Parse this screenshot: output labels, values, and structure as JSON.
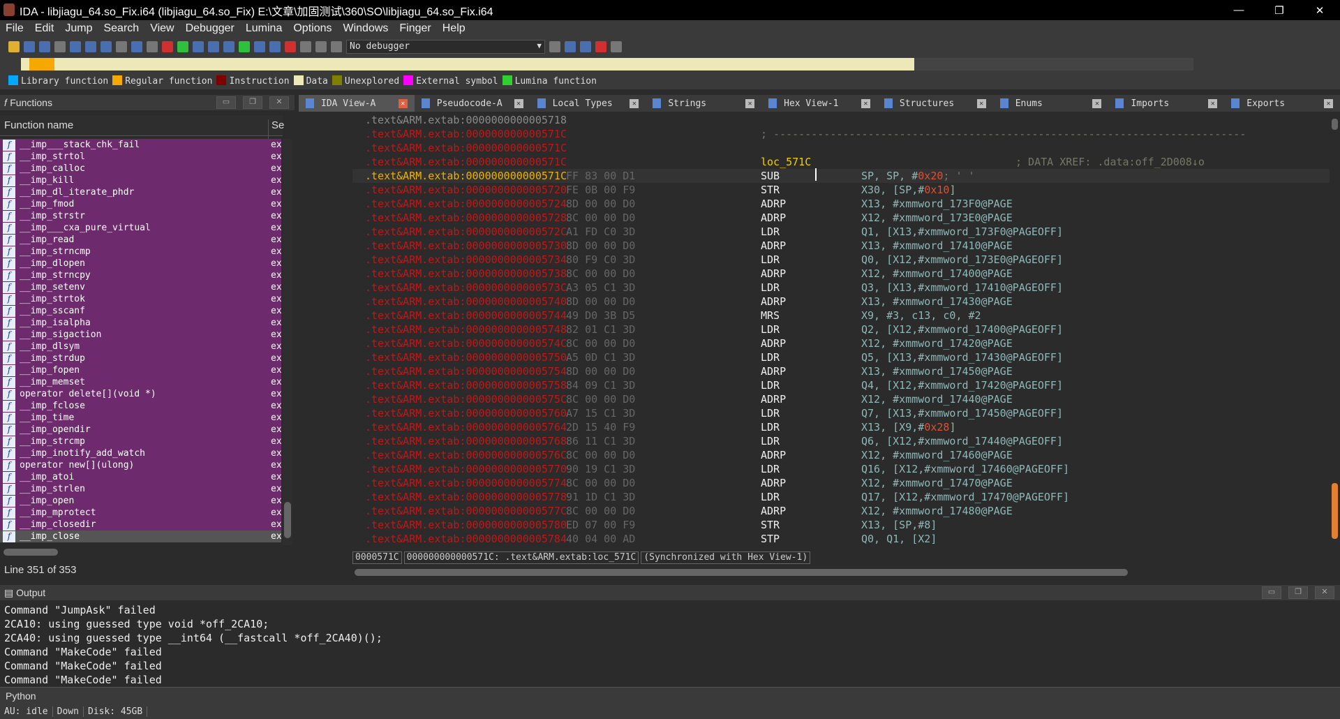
{
  "window": {
    "title": "IDA - libjiagu_64.so_Fix.i64 (libjiagu_64.so_Fix) E:\\文章\\加固测试\\360\\SO\\libjiagu_64.so_Fix.i64",
    "minimize": "—",
    "restore": "❐",
    "close": "✕"
  },
  "menu": [
    "File",
    "Edit",
    "Jump",
    "Search",
    "View",
    "Debugger",
    "Lumina",
    "Options",
    "Windows",
    "Finger",
    "Help"
  ],
  "toolbar": {
    "debugger_select": "No debugger"
  },
  "legend": [
    {
      "label": "Library function",
      "color": "#00a8ff"
    },
    {
      "label": "Regular function",
      "color": "#f5a800"
    },
    {
      "label": "Instruction",
      "color": "#800000"
    },
    {
      "label": "Data",
      "color": "#ede8b8"
    },
    {
      "label": "Unexplored",
      "color": "#808000"
    },
    {
      "label": "External symbol",
      "color": "#ff00ff"
    },
    {
      "label": "Lumina function",
      "color": "#30d030"
    }
  ],
  "functions": {
    "title": "Functions",
    "col_name": "Function name",
    "col_seg": "Se",
    "items": [
      "__imp___stack_chk_fail",
      "__imp_strtol",
      "__imp_calloc",
      "__imp_kill",
      "__imp_dl_iterate_phdr",
      "__imp_fmod",
      "__imp_strstr",
      "__imp___cxa_pure_virtual",
      "__imp_read",
      "__imp_strncmp",
      "__imp_dlopen",
      "__imp_strncpy",
      "__imp_setenv",
      "__imp_strtok",
      "__imp_sscanf",
      "__imp_isalpha",
      "__imp_sigaction",
      "__imp_dlsym",
      "__imp_strdup",
      "__imp_fopen",
      "__imp_memset",
      "operator delete[](void *)",
      "__imp_fclose",
      "__imp_time",
      "__imp_opendir",
      "__imp_strcmp",
      "__imp_inotify_add_watch",
      "operator new[](ulong)",
      "__imp_atoi",
      "__imp_strlen",
      "__imp_open",
      "__imp_mprotect",
      "__imp_closedir",
      "__imp_close"
    ],
    "seg": [
      "ex",
      "ex",
      "ex",
      "ex",
      "ex",
      "ex",
      "ex",
      "ex",
      "ex",
      "ex",
      "ex",
      "ex",
      "ex",
      "ex",
      "ex",
      "ex",
      "ex",
      "ex",
      "ex",
      "ex",
      "ex",
      "ex",
      "ex",
      "ex",
      "ex",
      "ex",
      "ex",
      "ex",
      "ex",
      "ex",
      "ex",
      "ex",
      "ex",
      "ex"
    ],
    "selected_index": 33,
    "line_info": "Line 351 of 353"
  },
  "tabs": [
    {
      "label": "IDA View-A",
      "active": true
    },
    {
      "label": "Pseudocode-A"
    },
    {
      "label": "Local Types"
    },
    {
      "label": "Strings"
    },
    {
      "label": "Hex View-1"
    },
    {
      "label": "Structures"
    },
    {
      "label": "Enums"
    },
    {
      "label": "Imports"
    },
    {
      "label": "Exports"
    }
  ],
  "disasm": [
    {
      "addr": ".text&ARM.extab:0000000000005718",
      "kind": "gray"
    },
    {
      "addr": ".text&ARM.extab:000000000000571C",
      "comment": "; ---------------------------------------------------------------------------"
    },
    {
      "addr": ".text&ARM.extab:000000000000571C"
    },
    {
      "addr": ".text&ARM.extab:000000000000571C",
      "label": "loc_571C",
      "xref": "; DATA XREF: .data:off_2D008↓o"
    },
    {
      "addr": ".text&ARM.extab:000000000000571C",
      "bytes": "FF 83 00 D1",
      "mn": "SUB",
      "op": "SP, SP, #",
      "num": "0x20",
      "tail": "",
      "cmt": " ; ' '",
      "cur": true
    },
    {
      "addr": ".text&ARM.extab:0000000000005720",
      "bytes": "FE 0B 00 F9",
      "mn": "STR",
      "op": "X30, [SP,#",
      "num": "0x10",
      "tail": "]"
    },
    {
      "addr": ".text&ARM.extab:0000000000005724",
      "bytes": "8D 00 00 D0",
      "mn": "ADRP",
      "op": "X13, #xmmword_173F0@PAGE"
    },
    {
      "addr": ".text&ARM.extab:0000000000005728",
      "bytes": "8C 00 00 D0",
      "mn": "ADRP",
      "op": "X12, #xmmword_173E0@PAGE"
    },
    {
      "addr": ".text&ARM.extab:000000000000572C",
      "bytes": "A1 FD C0 3D",
      "mn": "LDR",
      "op": "Q1, [X13,#xmmword_173F0@PAGEOFF]"
    },
    {
      "addr": ".text&ARM.extab:0000000000005730",
      "bytes": "8D 00 00 D0",
      "mn": "ADRP",
      "op": "X13, #xmmword_17410@PAGE"
    },
    {
      "addr": ".text&ARM.extab:0000000000005734",
      "bytes": "80 F9 C0 3D",
      "mn": "LDR",
      "op": "Q0, [X12,#xmmword_173E0@PAGEOFF]"
    },
    {
      "addr": ".text&ARM.extab:0000000000005738",
      "bytes": "8C 00 00 D0",
      "mn": "ADRP",
      "op": "X12, #xmmword_17400@PAGE"
    },
    {
      "addr": ".text&ARM.extab:000000000000573C",
      "bytes": "A3 05 C1 3D",
      "mn": "LDR",
      "op": "Q3, [X13,#xmmword_17410@PAGEOFF]"
    },
    {
      "addr": ".text&ARM.extab:0000000000005740",
      "bytes": "8D 00 00 D0",
      "mn": "ADRP",
      "op": "X13, #xmmword_17430@PAGE"
    },
    {
      "addr": ".text&ARM.extab:0000000000005744",
      "bytes": "49 D0 3B D5",
      "mn": "MRS",
      "op": "X9, #3, c13, c0, #2"
    },
    {
      "addr": ".text&ARM.extab:0000000000005748",
      "bytes": "82 01 C1 3D",
      "mn": "LDR",
      "op": "Q2, [X12,#xmmword_17400@PAGEOFF]"
    },
    {
      "addr": ".text&ARM.extab:000000000000574C",
      "bytes": "8C 00 00 D0",
      "mn": "ADRP",
      "op": "X12, #xmmword_17420@PAGE"
    },
    {
      "addr": ".text&ARM.extab:0000000000005750",
      "bytes": "A5 0D C1 3D",
      "mn": "LDR",
      "op": "Q5, [X13,#xmmword_17430@PAGEOFF]"
    },
    {
      "addr": ".text&ARM.extab:0000000000005754",
      "bytes": "8D 00 00 D0",
      "mn": "ADRP",
      "op": "X13, #xmmword_17450@PAGE"
    },
    {
      "addr": ".text&ARM.extab:0000000000005758",
      "bytes": "84 09 C1 3D",
      "mn": "LDR",
      "op": "Q4, [X12,#xmmword_17420@PAGEOFF]"
    },
    {
      "addr": ".text&ARM.extab:000000000000575C",
      "bytes": "8C 00 00 D0",
      "mn": "ADRP",
      "op": "X12, #xmmword_17440@PAGE"
    },
    {
      "addr": ".text&ARM.extab:0000000000005760",
      "bytes": "A7 15 C1 3D",
      "mn": "LDR",
      "op": "Q7, [X13,#xmmword_17450@PAGEOFF]"
    },
    {
      "addr": ".text&ARM.extab:0000000000005764",
      "bytes": "2D 15 40 F9",
      "mn": "LDR",
      "op": "X13, [X9,#",
      "num": "0x28",
      "tail": "]"
    },
    {
      "addr": ".text&ARM.extab:0000000000005768",
      "bytes": "86 11 C1 3D",
      "mn": "LDR",
      "op": "Q6, [X12,#xmmword_17440@PAGEOFF]"
    },
    {
      "addr": ".text&ARM.extab:000000000000576C",
      "bytes": "8C 00 00 D0",
      "mn": "ADRP",
      "op": "X12, #xmmword_17460@PAGE"
    },
    {
      "addr": ".text&ARM.extab:0000000000005770",
      "bytes": "90 19 C1 3D",
      "mn": "LDR",
      "op": "Q16, [X12,#xmmword_17460@PAGEOFF]"
    },
    {
      "addr": ".text&ARM.extab:0000000000005774",
      "bytes": "8C 00 00 D0",
      "mn": "ADRP",
      "op": "X12, #xmmword_17470@PAGE"
    },
    {
      "addr": ".text&ARM.extab:0000000000005778",
      "bytes": "91 1D C1 3D",
      "mn": "LDR",
      "op": "Q17, [X12,#xmmword_17470@PAGEOFF]"
    },
    {
      "addr": ".text&ARM.extab:000000000000577C",
      "bytes": "8C 00 00 D0",
      "mn": "ADRP",
      "op": "X12, #xmmword_17480@PAGE"
    },
    {
      "addr": ".text&ARM.extab:0000000000005780",
      "bytes": "ED 07 00 F9",
      "mn": "STR",
      "op": "X13, [SP,#8]"
    },
    {
      "addr": ".text&ARM.extab:0000000000005784",
      "bytes": "40 04 00 AD",
      "mn": "STP",
      "op": "Q0, Q1, [X2]"
    }
  ],
  "disasm_status": [
    "0000571C",
    "000000000000571C: .text&ARM.extab:loc_571C",
    "(Synchronized with Hex View-1)"
  ],
  "output": {
    "title": "Output",
    "lines": [
      "Command \"JumpAsk\" failed",
      "2CA10: using guessed type void *off_2CA10;",
      "2CA40: using guessed type __int64 (__fastcall *off_2CA40)();",
      "Command \"MakeCode\" failed",
      "Command \"MakeCode\" failed",
      "Command \"MakeCode\" failed"
    ]
  },
  "python_label": "Python",
  "status": {
    "au": "AU:  idle",
    "dir": "Down",
    "disk": "Disk: 45GB"
  }
}
